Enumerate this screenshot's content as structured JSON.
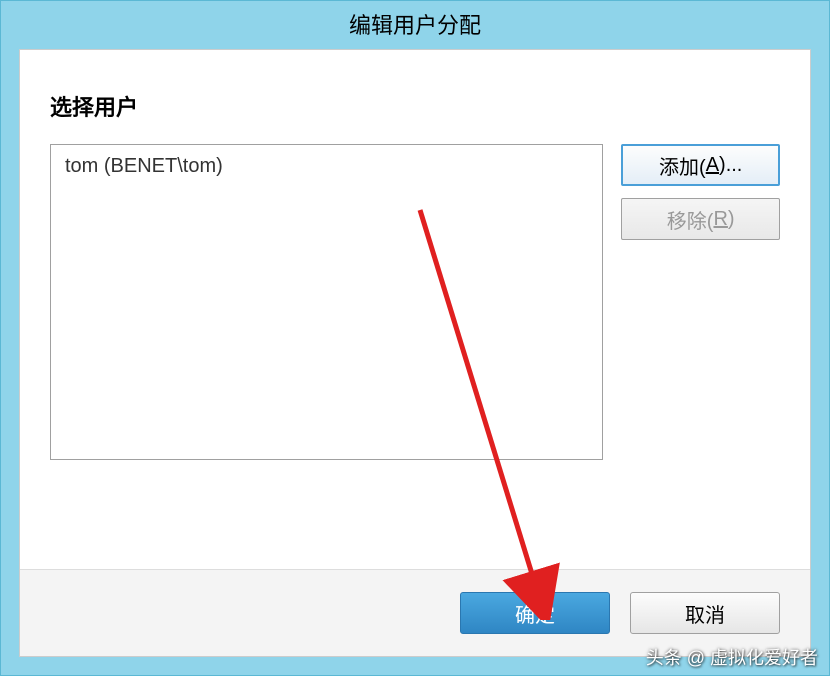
{
  "window": {
    "title": "编辑用户分配"
  },
  "section": {
    "label": "选择用户"
  },
  "user_list": {
    "items": [
      "tom (BENET\\tom)"
    ]
  },
  "buttons": {
    "add_prefix": "添加(",
    "add_hotkey": "A",
    "add_suffix": ")...",
    "remove_prefix": "移除(",
    "remove_hotkey": "R",
    "remove_suffix": ")",
    "ok": "确定",
    "cancel": "取消"
  },
  "watermark": "头条 @ 虚拟化爱好者"
}
